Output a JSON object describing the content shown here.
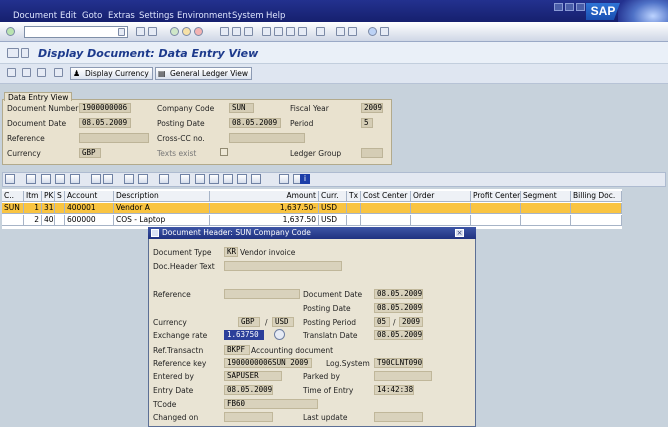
{
  "menu": {
    "items": [
      "Document",
      "Edit",
      "Goto",
      "Extras",
      "Settings",
      "Environment",
      "System",
      "Help"
    ],
    "logo": "SAP"
  },
  "title": "Display Document: Data Entry View",
  "app_toolbar": {
    "display_currency": "Display Currency",
    "general_ledger_view": "General Ledger View"
  },
  "header": {
    "group_title": "Data Entry View",
    "document_number_label": "Document Number",
    "document_number": "1900000006",
    "company_code_label": "Company Code",
    "company_code": "SUN",
    "fiscal_year_label": "Fiscal Year",
    "fiscal_year": "2009",
    "document_date_label": "Document Date",
    "document_date": "08.05.2009",
    "posting_date_label": "Posting Date",
    "posting_date": "08.05.2009",
    "period_label": "Period",
    "period": "5",
    "reference_label": "Reference",
    "cross_cc_label": "Cross-CC no.",
    "currency_label": "Currency",
    "currency": "GBP",
    "texts_exist_label": "Texts exist",
    "ledger_group_label": "Ledger Group"
  },
  "table": {
    "columns": [
      "C..",
      "Itm",
      "PK",
      "S",
      "Account",
      "Description",
      "Amount",
      "Curr.",
      "Tx",
      "Cost Center",
      "Order",
      "Profit Center",
      "Segment",
      "Billing Doc."
    ],
    "rows": [
      {
        "co": "SUN",
        "itm": "1",
        "pk": "31",
        "s": "",
        "account": "400001",
        "description": "Vendor A",
        "amount": "1,637.50-",
        "curr": "USD"
      },
      {
        "co": "",
        "itm": "2",
        "pk": "40",
        "s": "",
        "account": "600000",
        "description": "COS - Laptop",
        "amount": "1,637.50",
        "curr": "USD"
      }
    ]
  },
  "popup": {
    "title": "Document Header: SUN Company Code",
    "document_type_label": "Document Type",
    "document_type": "KR",
    "document_type_text": "Vendor invoice",
    "doc_header_text_label": "Doc.Header Text",
    "reference_label": "Reference",
    "document_date_label": "Document Date",
    "document_date": "08.05.2009",
    "posting_date_label": "Posting Date",
    "posting_date": "08.05.2009",
    "currency_label": "Currency",
    "currency": "GBP",
    "currency2": "USD",
    "posting_period_label": "Posting Period",
    "posting_period": "05",
    "posting_year": "2009",
    "exchange_rate_label": "Exchange rate",
    "exchange_rate": "1.63750",
    "translatn_date_label": "Translatn Date",
    "translatn_date": "08.05.2009",
    "ref_transactn_label": "Ref.Transactn",
    "ref_transactn": "BKPF",
    "ref_transactn_text": "Accounting document",
    "reference_key_label": "Reference key",
    "reference_key": "1900000006SUN 2009",
    "log_system_label": "Log.System",
    "log_system": "T90CLNT090",
    "entered_by_label": "Entered by",
    "entered_by": "SAPUSER",
    "parked_by_label": "Parked by",
    "entry_date_label": "Entry Date",
    "entry_date": "08.05.2009",
    "time_of_entry_label": "Time of Entry",
    "time_of_entry": "14:42:38",
    "tcode_label": "TCode",
    "tcode": "FB60",
    "changed_on_label": "Changed on",
    "last_update_label": "Last update"
  }
}
